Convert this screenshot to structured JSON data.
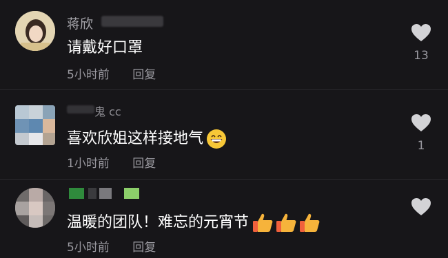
{
  "comments": [
    {
      "username": "蒋欣",
      "text": "请戴好口罩",
      "time": "5小时前",
      "reply_label": "回复",
      "likes": "13",
      "icons": [
        "heart-icon"
      ]
    },
    {
      "username": "鬼 cc",
      "text": "喜欢欣姐这样接地气",
      "time": "1小时前",
      "reply_label": "回复",
      "likes": "1",
      "icons": [
        "grinning-face-emoji",
        "heart-icon"
      ]
    },
    {
      "username": "",
      "text": "温暖的团队！难忘的元宵节",
      "time": "5小时前",
      "reply_label": "回复",
      "likes": "",
      "icons": [
        "thumbs-up-emoji",
        "thumbs-up-emoji",
        "thumbs-up-emoji",
        "heart-icon"
      ]
    }
  ],
  "colors": {
    "background": "#171619",
    "username": "#a6a5ab",
    "meta": "#9a99a0",
    "heart": "#d3d3d6"
  }
}
